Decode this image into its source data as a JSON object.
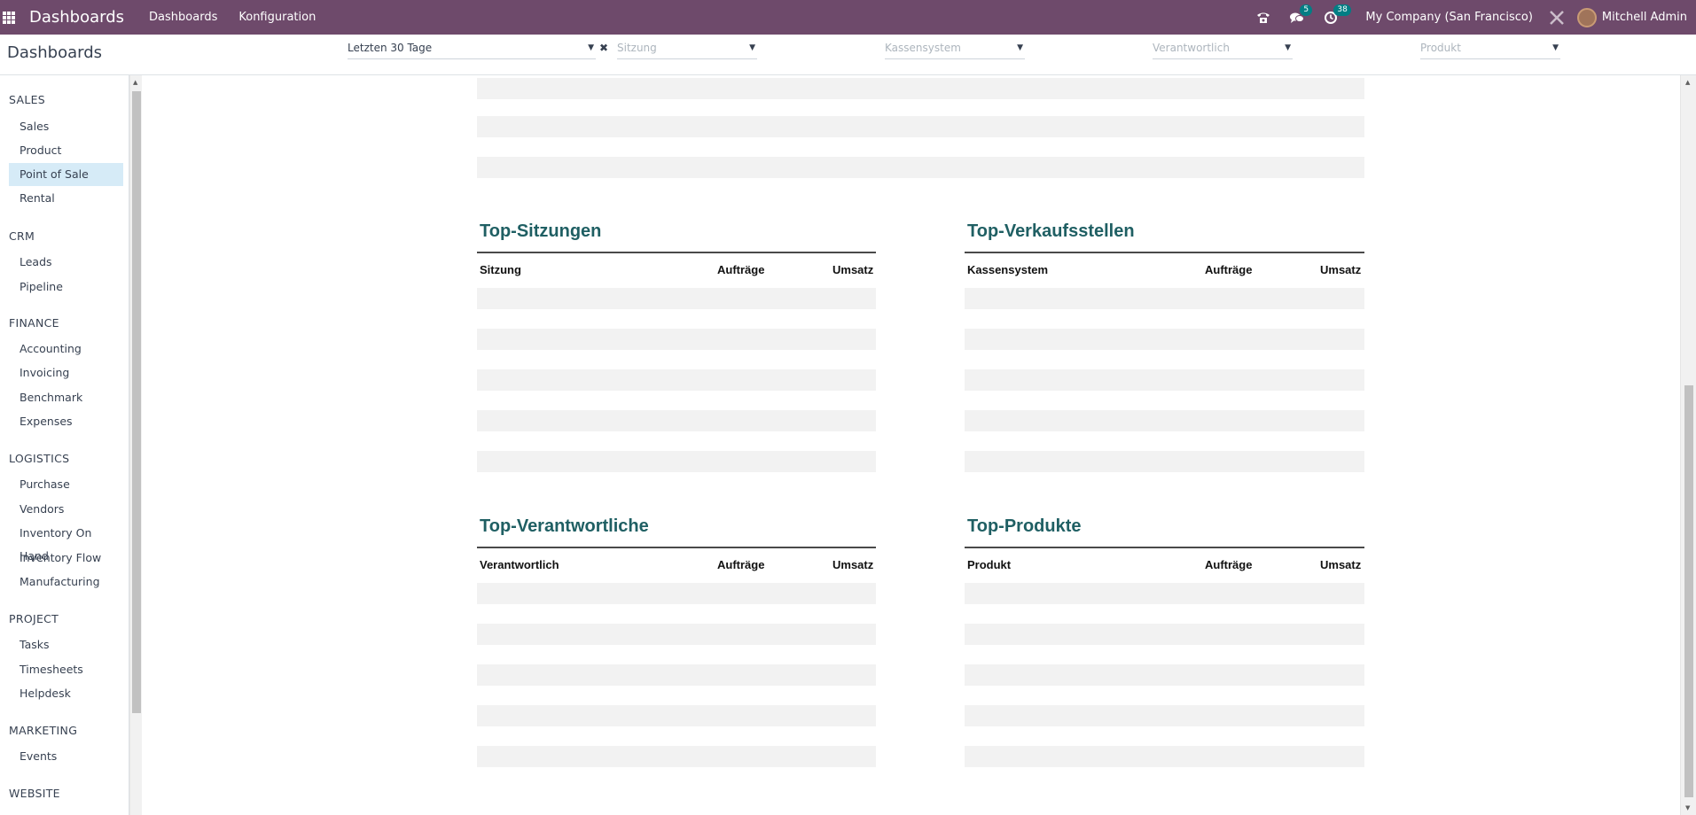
{
  "navbar": {
    "brand": "Dashboards",
    "menus": [
      "Dashboards",
      "Konfiguration"
    ],
    "messages_count": "5",
    "activities_count": "38",
    "company": "My Company (San Francisco)",
    "user": "Mitchell Admin"
  },
  "control": {
    "title": "Dashboards",
    "filters": {
      "period": "Letzten 30 Tage",
      "session_placeholder": "Sitzung",
      "pos_placeholder": "Kassensystem",
      "responsible_placeholder": "Verantwortlich",
      "product_placeholder": "Produkt"
    }
  },
  "sidebar": {
    "sections": [
      {
        "title": "SALES",
        "items": [
          "Sales",
          "Product",
          "Point of Sale",
          "Rental"
        ]
      },
      {
        "title": "CRM",
        "items": [
          "Leads",
          "Pipeline"
        ]
      },
      {
        "title": "FINANCE",
        "items": [
          "Accounting",
          "Invoicing",
          "Benchmark",
          "Expenses"
        ]
      },
      {
        "title": "LOGISTICS",
        "items": [
          "Purchase",
          "Vendors",
          "Inventory On Hand",
          "Inventory Flow",
          "Manufacturing"
        ]
      },
      {
        "title": "PROJECT",
        "items": [
          "Tasks",
          "Timesheets",
          "Helpdesk"
        ]
      },
      {
        "title": "MARKETING",
        "items": [
          "Events"
        ]
      },
      {
        "title": "WEBSITE",
        "items": []
      }
    ],
    "active_item": "Point of Sale"
  },
  "dashboard": {
    "blocks": [
      {
        "title": "Top-Sitzungen",
        "columns": [
          "Sitzung",
          "Aufträge",
          "Umsatz"
        ]
      },
      {
        "title": "Top-Verkaufsstellen",
        "columns": [
          "Kassensystem",
          "Aufträge",
          "Umsatz"
        ]
      },
      {
        "title": "Top-Verantwortliche",
        "columns": [
          "Verantwortlich",
          "Aufträge",
          "Umsatz"
        ]
      },
      {
        "title": "Top-Produkte",
        "columns": [
          "Produkt",
          "Aufträge",
          "Umsatz"
        ]
      }
    ]
  },
  "colors": {
    "navbar": "#6e4a6b",
    "accent_teal": "#1f5f63",
    "active_item_bg": "#d6ebf7",
    "placeholder_row": "#f2f2f2"
  }
}
